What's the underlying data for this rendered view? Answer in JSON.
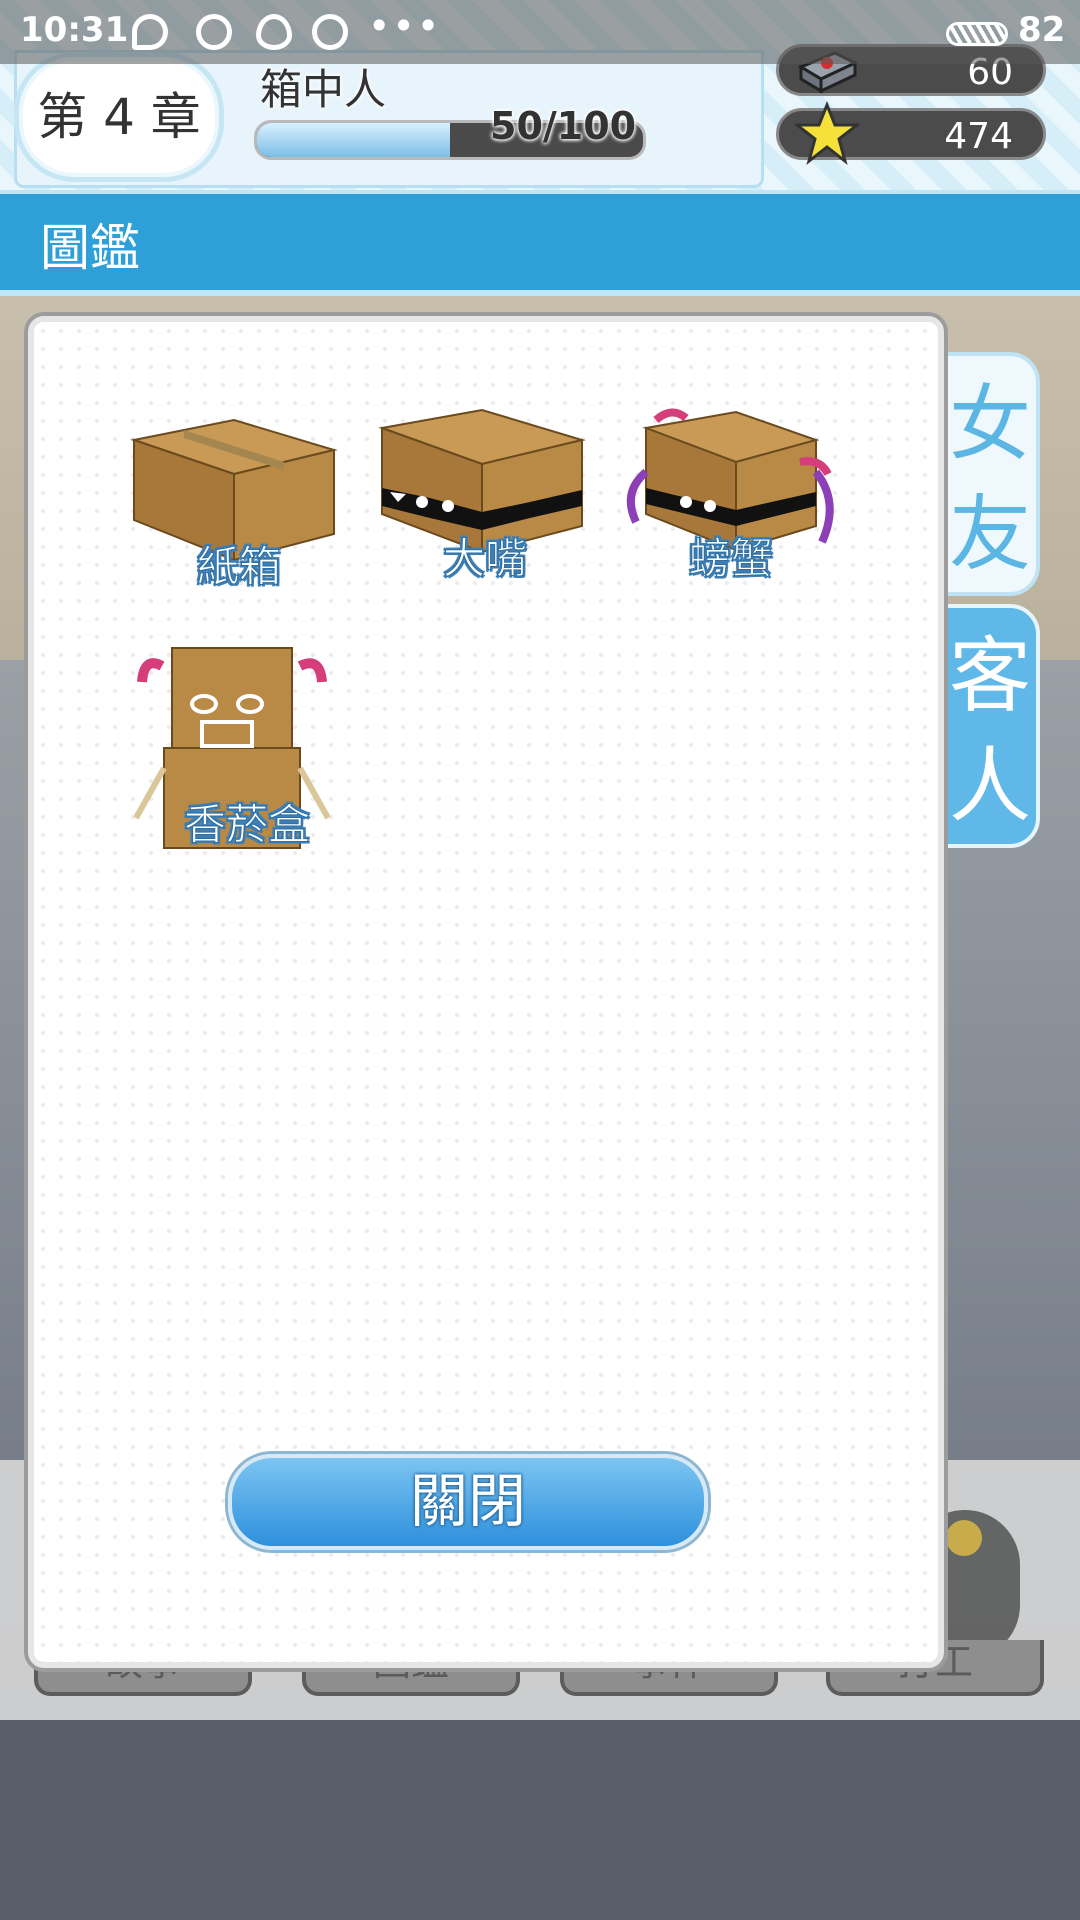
{
  "status_bar": {
    "time": "10:31",
    "dots": "•••",
    "battery": "82"
  },
  "header": {
    "chapter": "第 4 章",
    "chapter_title": "箱中人",
    "progress_text": "50/100",
    "progress_fraction": 0.5,
    "resources": [
      {
        "name": "box-ticket",
        "value": "60"
      },
      {
        "name": "star",
        "value": "474"
      }
    ]
  },
  "section": {
    "title": "圖鑑"
  },
  "tabs": [
    {
      "label": "女友",
      "active": false
    },
    {
      "label": "客人",
      "active": true
    }
  ],
  "collection": [
    {
      "name": "紙箱",
      "icon": "cardboard-box"
    },
    {
      "name": "大嘴",
      "icon": "bigmouth-box"
    },
    {
      "name": "螃蟹",
      "icon": "crab-box"
    },
    {
      "name": "香菸盒",
      "icon": "cigarette-box-robot"
    }
  ],
  "close_label": "關閉",
  "background_buttons": [
    "故事",
    "圖鑑",
    "事件",
    "打工"
  ],
  "colors": {
    "accent": "#2f9fd8",
    "tab_active": "#5fb8e7",
    "box": "#b88a46"
  }
}
